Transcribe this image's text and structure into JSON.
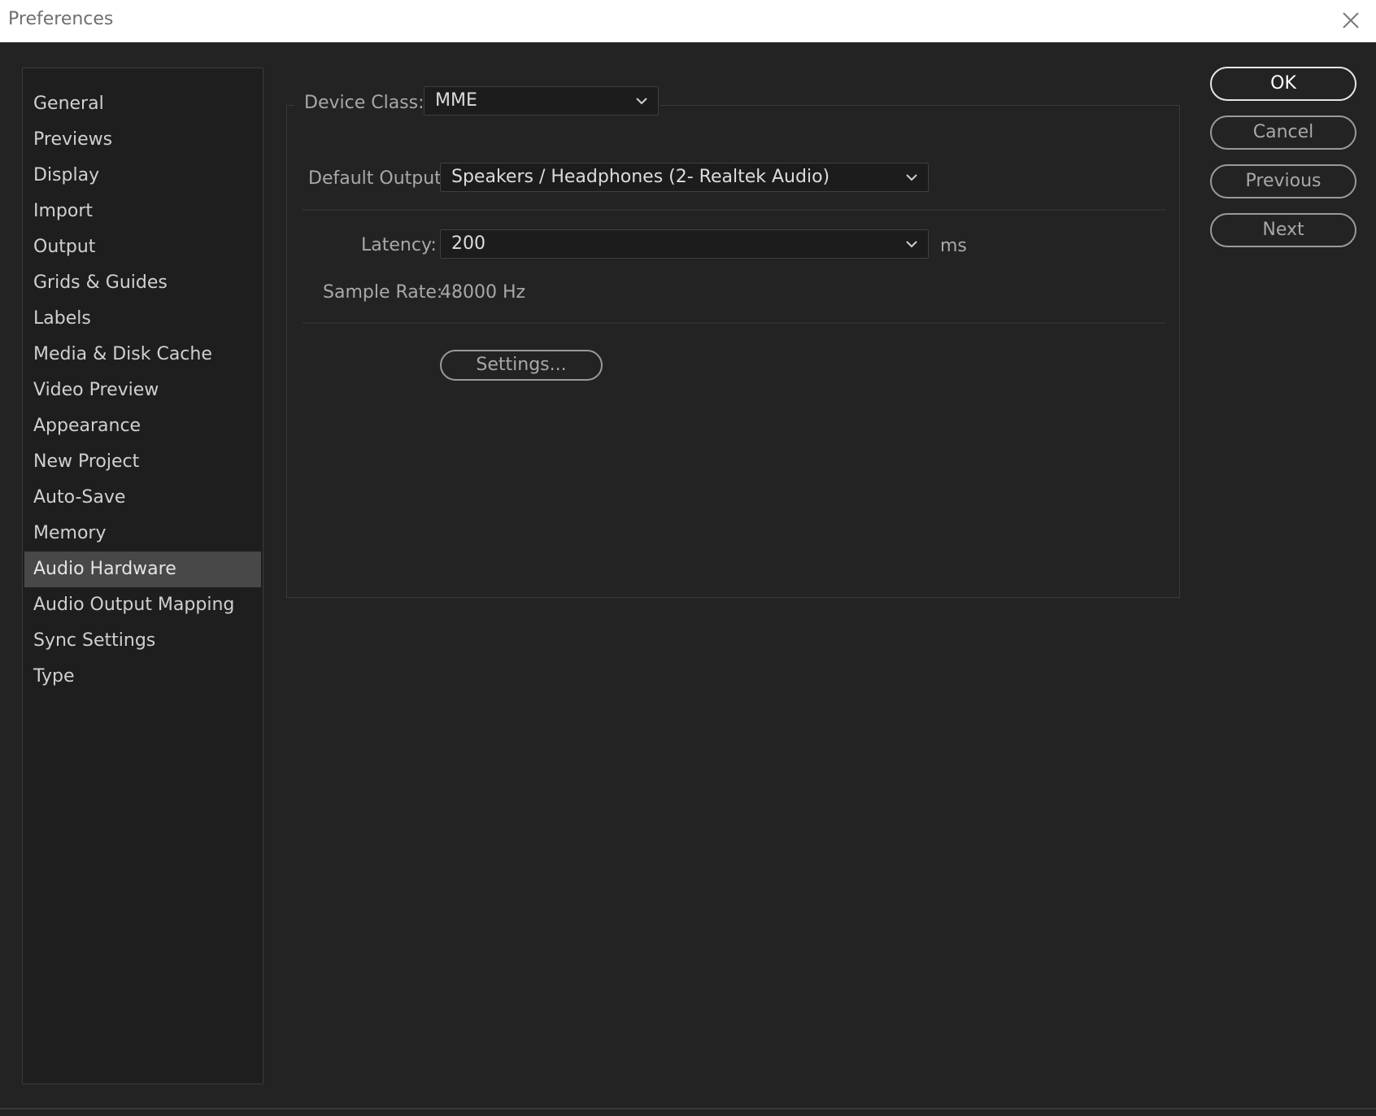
{
  "window": {
    "title": "Preferences"
  },
  "sidebar": {
    "selected_index": 13,
    "items": [
      {
        "label": "General"
      },
      {
        "label": "Previews"
      },
      {
        "label": "Display"
      },
      {
        "label": "Import"
      },
      {
        "label": "Output"
      },
      {
        "label": "Grids & Guides"
      },
      {
        "label": "Labels"
      },
      {
        "label": "Media & Disk Cache"
      },
      {
        "label": "Video Preview"
      },
      {
        "label": "Appearance"
      },
      {
        "label": "New Project"
      },
      {
        "label": "Auto-Save"
      },
      {
        "label": "Memory"
      },
      {
        "label": "Audio Hardware"
      },
      {
        "label": "Audio Output Mapping"
      },
      {
        "label": "Sync Settings"
      },
      {
        "label": "Type"
      }
    ]
  },
  "audio": {
    "device_class_label": "Device Class:",
    "device_class_value": "MME",
    "default_output_label": "Default Output:",
    "default_output_value": "Speakers / Headphones (2- Realtek Audio)",
    "latency_label": "Latency:",
    "latency_value": "200",
    "latency_unit": "ms",
    "sample_rate_label": "Sample Rate:",
    "sample_rate_value": "48000 Hz",
    "settings_label": "Settings..."
  },
  "buttons": {
    "ok": "OK",
    "cancel": "Cancel",
    "previous": "Previous",
    "next": "Next"
  },
  "icons": {
    "close": "close-icon",
    "dropdown": "chevron-down-icon"
  }
}
